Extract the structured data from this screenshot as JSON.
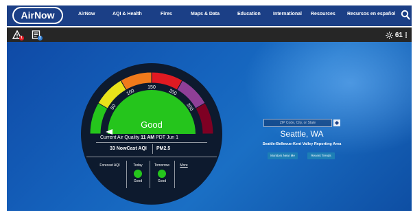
{
  "nav": {
    "logo_text": "AirNow",
    "items": [
      "AirNow",
      "AQI & Health",
      "Fires",
      "Maps & Data",
      "Education",
      "International",
      "Resources",
      "Recursos en español"
    ]
  },
  "alert_bar": {
    "alert_count": "1",
    "notice_count": "2",
    "temperature": "61"
  },
  "dial": {
    "scale_labels": [
      "50",
      "100",
      "150",
      "200",
      "300"
    ],
    "category": "Good",
    "category_color": "#25c51c",
    "segment_colors": [
      "#25c51c",
      "#e9e21a",
      "#f07a1b",
      "#e01a22",
      "#8f3f97",
      "#7e0023"
    ]
  },
  "current": {
    "prefix": "Current Air Quality",
    "time": "11 AM",
    "suffix": "PDT Jun 1",
    "aqi_value": "33",
    "aqi_label": "NowCast AQI",
    "pollutant": "PM2.5"
  },
  "forecast": {
    "label": "Forecast AQI",
    "days": [
      {
        "name": "Today",
        "status": "Good"
      },
      {
        "name": "Tomorrow",
        "status": "Good"
      }
    ],
    "more": "More"
  },
  "location": {
    "zip_placeholder": "ZIP Code, City, or State",
    "city": "Seattle, WA",
    "area": "Seattle-Bellevue-Kent Valley Reporting Area",
    "monitors_button": "Monitors Near Me",
    "trends_button": "Recent Trends"
  }
}
